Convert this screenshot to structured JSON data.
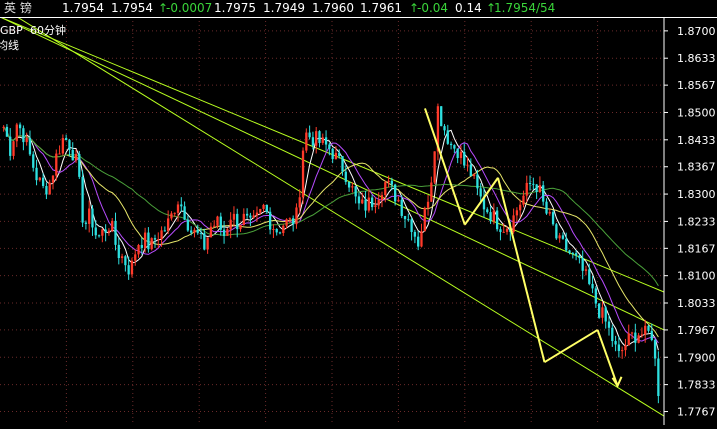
{
  "quote_bar": {
    "name": "英    镑",
    "price": "1.7954",
    "last": "1.7954",
    "change": "-0.0007",
    "open": "1.7975",
    "low": "1.7949",
    "high": "1.7960",
    "close": "1.7961",
    "change_pct": "-0.04",
    "volume": "0.14",
    "bid_ask": "1.7954/54",
    "up_arrow": "↑",
    "up_color": "#3ad43a"
  },
  "chart_overlay": {
    "symbol": "GBP",
    "period": "60分钟",
    "line_type": "均线"
  },
  "chart_data": {
    "type": "candlestick",
    "ylim": [
      1.7734,
      1.8734
    ],
    "ytick_labels": [
      "1.8700",
      "1.8633",
      "1.8567",
      "1.8500",
      "1.8433",
      "1.8367",
      "1.8300",
      "1.8233",
      "1.8167",
      "1.8100",
      "1.8033",
      "1.7967",
      "1.7900",
      "1.7833",
      "1.7767"
    ],
    "grid": true,
    "colors": {
      "up": "#ff3a2a",
      "down": "#2ee0e0",
      "ma_short": "#ffffff",
      "ma_mid": "#b74cff",
      "ma_long": "#e6e66a",
      "ma_longest": "#4aa03a",
      "channel": "#b8ff20",
      "trend": "#ffff66",
      "grid": "#6a2a2a",
      "axis": "#ffffff"
    },
    "price_path": [
      1.8465,
      1.841,
      1.8475,
      1.8445,
      1.839,
      1.834,
      1.831,
      1.833,
      1.84,
      1.844,
      1.842,
      1.837,
      1.822,
      1.825,
      1.819,
      1.821,
      1.823,
      1.816,
      1.814,
      1.811,
      1.818,
      1.819,
      1.817,
      1.82,
      1.821,
      1.824,
      1.829,
      1.826,
      1.821,
      1.82,
      1.817,
      1.822,
      1.823,
      1.82,
      1.825,
      1.823,
      1.824,
      1.822,
      1.824,
      1.827,
      1.823,
      1.821,
      1.823,
      1.823,
      1.825,
      1.845,
      1.844,
      1.843,
      1.842,
      1.841,
      1.838,
      1.836,
      1.832,
      1.827,
      1.827,
      1.828,
      1.83,
      1.833,
      1.831,
      1.829,
      1.825,
      1.823,
      1.818,
      1.825,
      1.834,
      1.851,
      1.846,
      1.842,
      1.841,
      1.837,
      1.835,
      1.83,
      1.827,
      1.825,
      1.823,
      1.822,
      1.823,
      1.827,
      1.83,
      1.833,
      1.832,
      1.826,
      1.823,
      1.818,
      1.817,
      1.815,
      1.813,
      1.81,
      1.806,
      1.802,
      1.799,
      1.795,
      1.79,
      1.793,
      1.795,
      1.796,
      1.7955,
      1.796,
      1.782
    ],
    "channel_lines": [
      {
        "x": [
          0.0,
          1.0
        ],
        "y": [
          1.8734,
          1.806
        ]
      },
      {
        "x": [
          0.0,
          1.0
        ],
        "y": [
          1.8734,
          1.7967
        ]
      },
      {
        "x": [
          0.0,
          1.0
        ],
        "y": [
          1.876,
          1.7756
        ]
      }
    ],
    "trend_lines": [
      {
        "x": [
          0.64,
          0.7
        ],
        "y": [
          1.851,
          1.8225
        ]
      },
      {
        "x": [
          0.7,
          0.75
        ],
        "y": [
          1.8225,
          1.834
        ]
      },
      {
        "x": [
          0.75,
          0.82
        ],
        "y": [
          1.834,
          1.7888
        ]
      },
      {
        "x": [
          0.82,
          0.9
        ],
        "y": [
          1.7888,
          1.7967
        ]
      },
      {
        "x": [
          0.9,
          0.93
        ],
        "y": [
          1.7967,
          1.783
        ]
      }
    ]
  }
}
